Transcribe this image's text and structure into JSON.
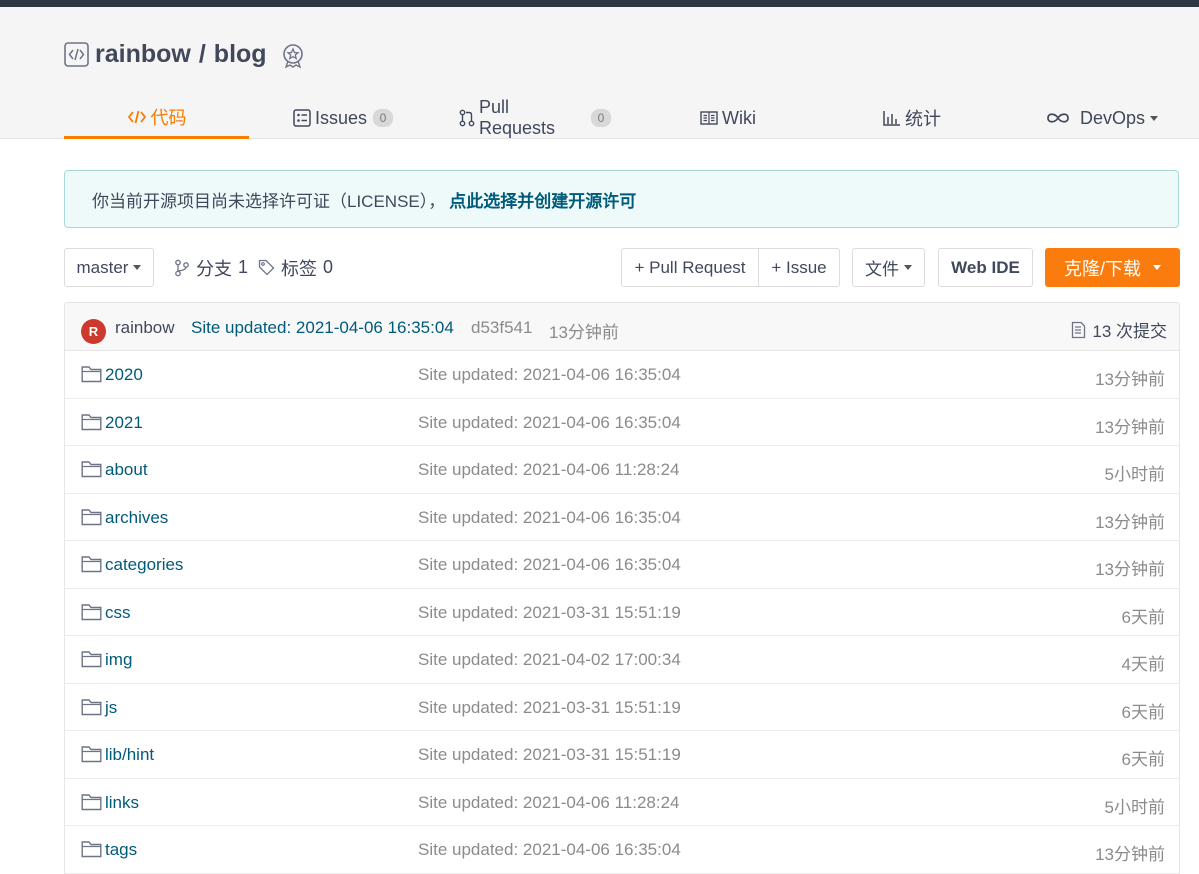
{
  "repo": {
    "owner": "rainbow",
    "separator": "/",
    "name": "blog"
  },
  "tabs": [
    {
      "label": "代码",
      "icon": "code-icon",
      "active": true
    },
    {
      "label": "Issues",
      "icon": "issues-icon",
      "count": "0"
    },
    {
      "label": "Pull Requests",
      "icon": "pull-request-icon",
      "count": "0"
    },
    {
      "label": "Wiki",
      "icon": "wiki-book-icon"
    },
    {
      "label": "统计",
      "icon": "bar-chart-icon"
    },
    {
      "label": "DevOps",
      "icon": "infinity-icon"
    }
  ],
  "notice": {
    "text": "你当前开源项目尚未选择许可证（LICENSE），",
    "link": "点此选择并创建开源许可"
  },
  "toolbar": {
    "branch": "master",
    "branches_label": "分支",
    "branches_count": "1",
    "tags_label": "标签",
    "tags_count": "0",
    "pull_request_btn": "+ Pull Request",
    "issue_btn": "+ Issue",
    "file_btn": "文件",
    "web_ide_btn": "Web IDE",
    "clone_btn": "克隆/下载"
  },
  "commit": {
    "avatar_letter": "R",
    "author": "rainbow",
    "message": "Site updated: 2021-04-06 16:35:04",
    "sha": "d53f541",
    "time": "13分钟前",
    "count_label": "13 次提交"
  },
  "files": [
    {
      "name": "2020",
      "message": "Site updated: 2021-04-06 16:35:04",
      "time": "13分钟前"
    },
    {
      "name": "2021",
      "message": "Site updated: 2021-04-06 16:35:04",
      "time": "13分钟前"
    },
    {
      "name": "about",
      "message": "Site updated: 2021-04-06 11:28:24",
      "time": "5小时前"
    },
    {
      "name": "archives",
      "message": "Site updated: 2021-04-06 16:35:04",
      "time": "13分钟前"
    },
    {
      "name": "categories",
      "message": "Site updated: 2021-04-06 16:35:04",
      "time": "13分钟前"
    },
    {
      "name": "css",
      "message": "Site updated: 2021-03-31 15:51:19",
      "time": "6天前"
    },
    {
      "name": "img",
      "message": "Site updated: 2021-04-02 17:00:34",
      "time": "4天前"
    },
    {
      "name": "js",
      "message": "Site updated: 2021-03-31 15:51:19",
      "time": "6天前"
    },
    {
      "name": "lib/hint",
      "message": "Site updated: 2021-03-31 15:51:19",
      "time": "6天前"
    },
    {
      "name": "links",
      "message": "Site updated: 2021-04-06 11:28:24",
      "time": "5小时前"
    },
    {
      "name": "tags",
      "message": "Site updated: 2021-04-06 16:35:04",
      "time": "13分钟前"
    }
  ],
  "colors": {
    "accent": "#f87c00",
    "link": "#005a7a",
    "muted": "#8b8b8b",
    "header_bg": "#f5f5f5"
  }
}
